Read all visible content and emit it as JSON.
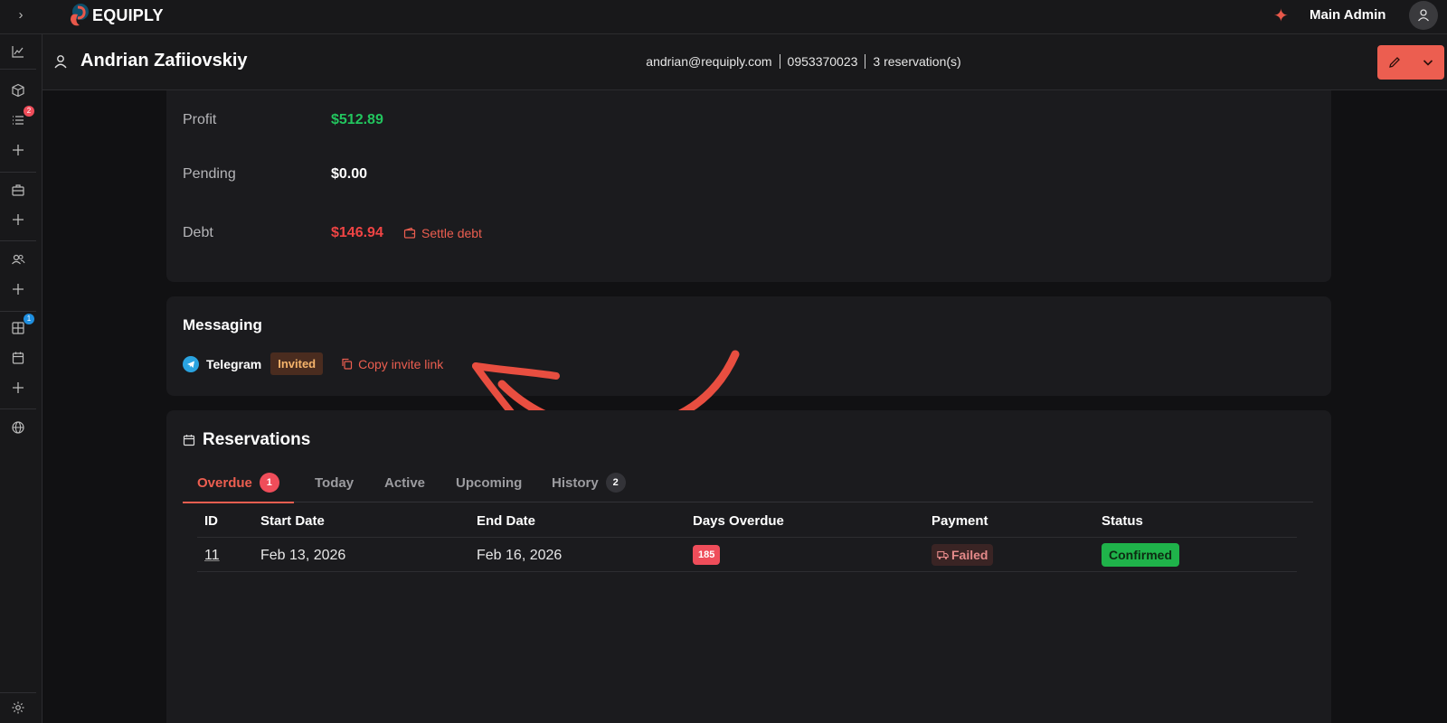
{
  "topbar": {
    "brand": "EQUIPLY",
    "admin_name": "Main Admin"
  },
  "sidebar": {
    "badges": {
      "reservations": "2",
      "boards": "1"
    }
  },
  "customer": {
    "name": "Andrian Zafiiovskiy",
    "email": "andrian@requiply.com",
    "phone": "0953370023",
    "reservations_count": "3 reservation(s)"
  },
  "finance": {
    "profit_label": "Profit",
    "profit_value": "$512.89",
    "pending_label": "Pending",
    "pending_value": "$0.00",
    "debt_label": "Debt",
    "debt_value": "$146.94",
    "settle_label": "Settle debt"
  },
  "messaging": {
    "title": "Messaging",
    "channel": "Telegram",
    "status": "Invited",
    "copy_label": "Copy invite link"
  },
  "reservations": {
    "title": "Reservations",
    "tabs": [
      {
        "label": "Overdue",
        "count": "1"
      },
      {
        "label": "Today"
      },
      {
        "label": "Active"
      },
      {
        "label": "Upcoming"
      },
      {
        "label": "History",
        "count": "2"
      }
    ],
    "columns": [
      "ID",
      "Start Date",
      "End Date",
      "Days Overdue",
      "Payment",
      "Status"
    ],
    "rows": [
      {
        "id": "11",
        "start": "Feb 13, 2026",
        "end": "Feb 16, 2026",
        "days_overdue": "185",
        "payment": "Failed",
        "status": "Confirmed"
      }
    ]
  },
  "colors": {
    "accent": "#ec5e50",
    "profit": "#22c55e",
    "debt": "#ef4444",
    "confirmed": "#1fb34a"
  }
}
